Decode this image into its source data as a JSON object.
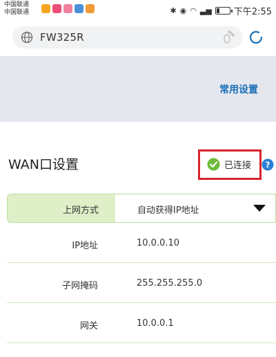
{
  "status_bar": {
    "carrier_1": "中国联通",
    "carrier_2": "中国联通",
    "clock": "下午2:55",
    "battery_level": 0.2,
    "app_badge_colors": [
      "#f5a623",
      "#e94e77",
      "#f07fa0",
      "#4a90d9",
      "#f29c38"
    ]
  },
  "browser": {
    "url": "FW325R",
    "icons": [
      "globe-icon",
      "footprint-icon",
      "refresh-icon"
    ]
  },
  "header": {
    "common_settings": "常用设置"
  },
  "wan": {
    "title": "WAN口设置",
    "status": "已连接",
    "status_color": "#6dbb3a",
    "highlight_color": "#d9232e",
    "help_color": "#2a7fd4"
  },
  "table": {
    "connection_label": "上网方式",
    "connection_value": "自动获得IP地址",
    "rows": [
      {
        "label": "IP地址",
        "value": "10.0.0.10"
      },
      {
        "label": "子网掩码",
        "value": "255.255.255.0"
      },
      {
        "label": "网关",
        "value": "10.0.0.1"
      }
    ]
  }
}
